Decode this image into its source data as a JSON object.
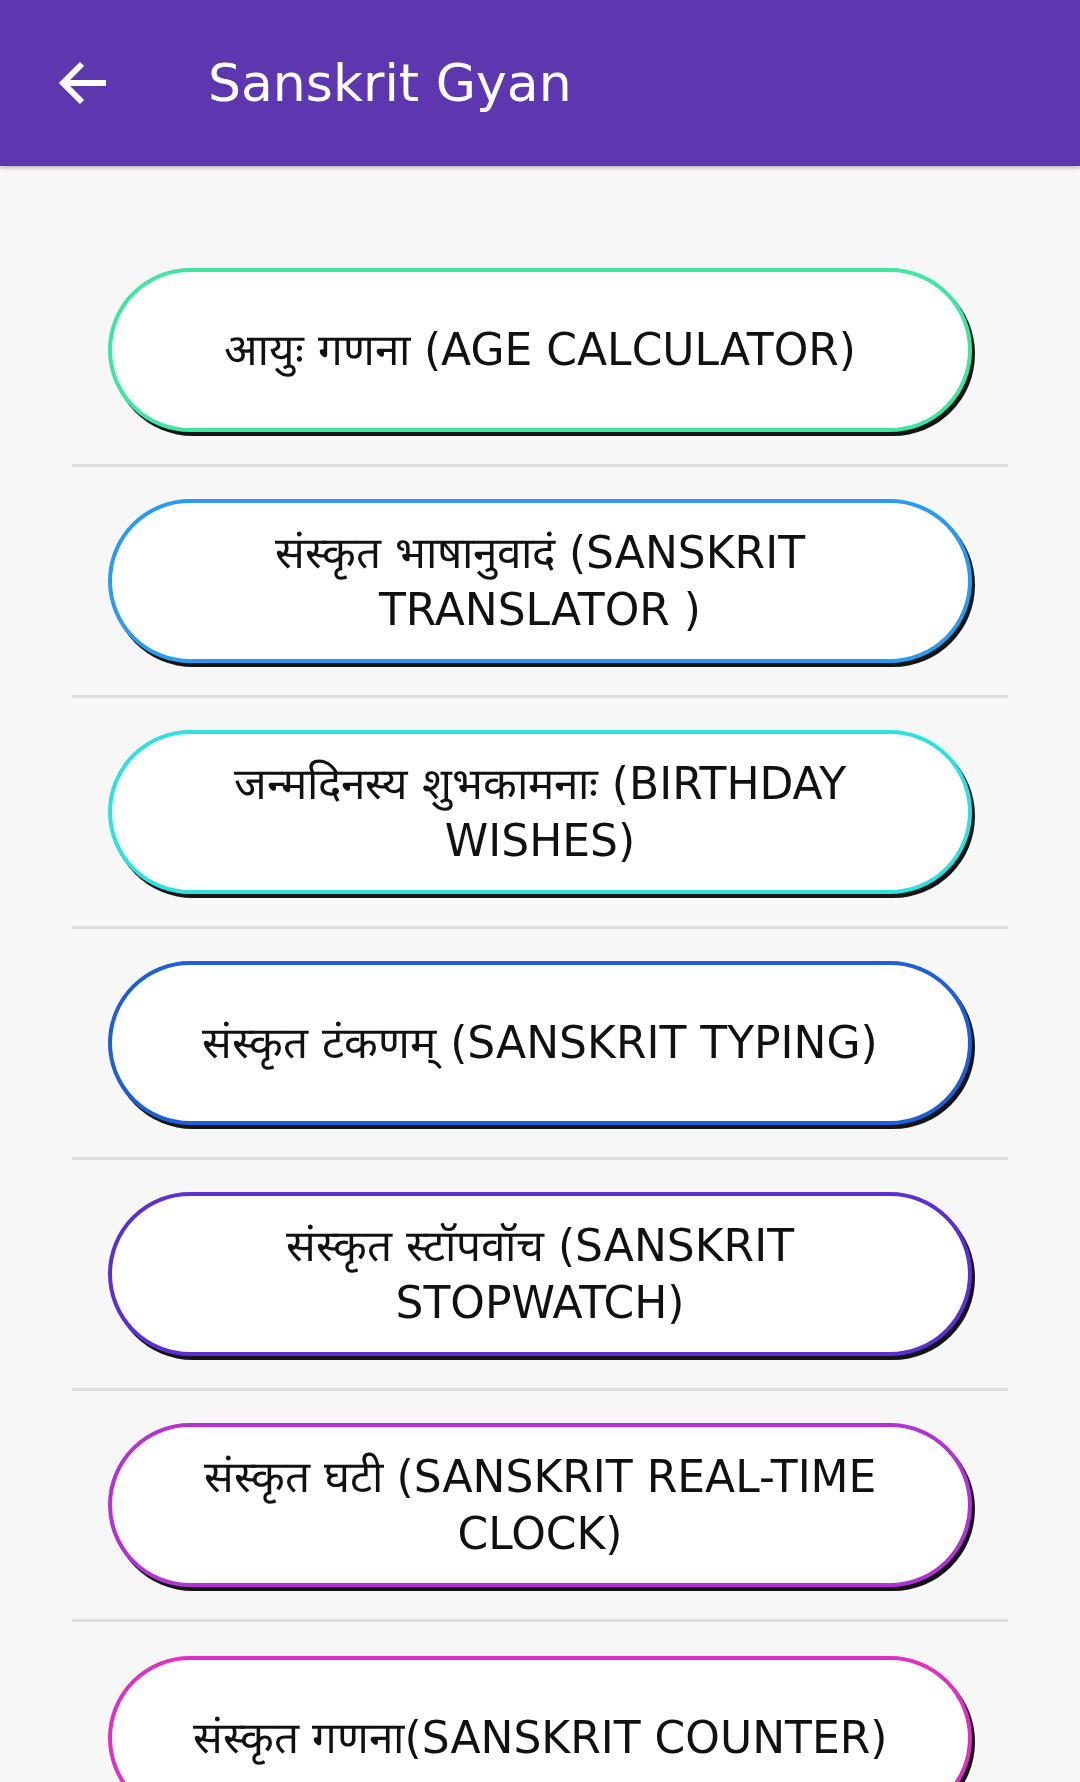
{
  "app_bar": {
    "title": "Sanskrit Gyan"
  },
  "menu_items": [
    {
      "label": "आयुः गणना (AGE CALCULATOR)",
      "color": "#3ee6a2"
    },
    {
      "label": "संस्कृत भाषानुवादं (SANSKRIT TRANSLATOR )",
      "color": "#2a9cf0"
    },
    {
      "label": "जन्मदिनस्य शुभकामनाः (BIRTHDAY WISHES)",
      "color": "#2ee0e0"
    },
    {
      "label": "संस्कृत टंकणम् (SANSKRIT TYPING)",
      "color": "#1c5fd6"
    },
    {
      "label": "संस्कृत स्टॉपवॉच (SANSKRIT STOPWATCH)",
      "color": "#5b2fd2"
    },
    {
      "label": "संस्कृत घटी (SANSKRIT REAL-TIME CLOCK)",
      "color": "#b232d4"
    },
    {
      "label": "संस्कृत गणना(SANSKRIT COUNTER)",
      "color": "#e030c4"
    }
  ]
}
